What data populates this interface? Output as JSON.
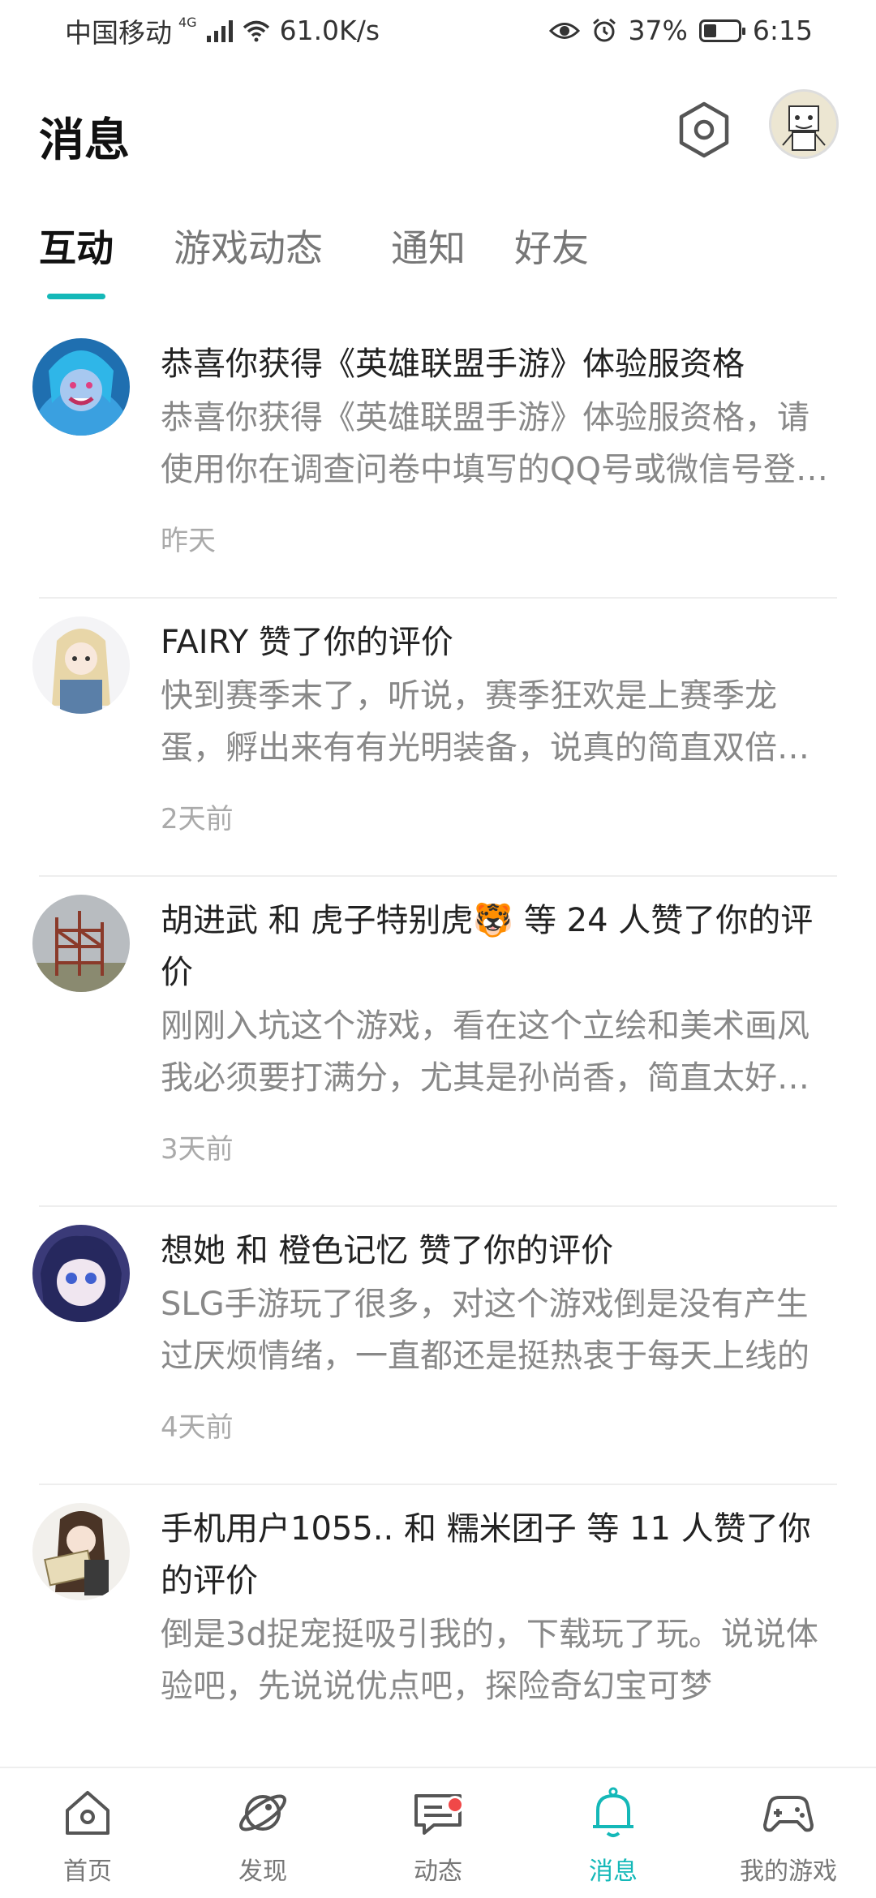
{
  "status_bar": {
    "carrier": "中国移动",
    "network": "4G",
    "speed": "61.0K/s",
    "battery": "37%",
    "battery_level": 0.37,
    "time": "6:15"
  },
  "header": {
    "title": "消息"
  },
  "tabs": [
    {
      "label": "互动",
      "active": true
    },
    {
      "label": "游戏动态",
      "active": false
    },
    {
      "label": "通知",
      "active": false
    },
    {
      "label": "好友",
      "active": false
    }
  ],
  "messages": [
    {
      "title": "恭喜你获得《英雄联盟手游》体验服资格",
      "preview": "恭喜你获得《英雄联盟手游》体验服资格，请使用你在调查问卷中填写的QQ号或微信号登录游戏",
      "time": "昨天"
    },
    {
      "title": "FAIRY 赞了你的评价",
      "preview": "快到赛季末了，听说，赛季狂欢是上赛季龙蛋，孵出来有有光明装备，说真的简直双倍快乐",
      "time": "2天前"
    },
    {
      "title": "胡进武 和 虎子特别虎🐯 等 24 人赞了你的评价",
      "preview": "刚刚入坑这个游戏，看在这个立绘和美术画风我必须要打满分，尤其是孙尚香，简直太好看了",
      "time": "3天前"
    },
    {
      "title": "想她 和 橙色记忆 赞了你的评价",
      "preview": "SLG手游玩了很多，对这个游戏倒是没有产生过厌烦情绪，一直都还是挺热衷于每天上线的",
      "time": "4天前"
    },
    {
      "title": "手机用户1055.. 和 糯米团子 等 11 人赞了你的评价",
      "preview": "倒是3d捉宠挺吸引我的，下载玩了玩。说说体验吧，先说说优点吧，探险奇幻宝可梦",
      "time": ""
    }
  ],
  "bottom_nav": [
    {
      "label": "首页",
      "icon": "home-icon",
      "active": false
    },
    {
      "label": "发现",
      "icon": "planet-icon",
      "active": false
    },
    {
      "label": "动态",
      "icon": "chat-icon",
      "active": false,
      "badge": true
    },
    {
      "label": "消息",
      "icon": "bell-icon",
      "active": true
    },
    {
      "label": "我的游戏",
      "icon": "gamepad-icon",
      "active": false
    }
  ],
  "colors": {
    "accent": "#14b8b8",
    "badge": "#f04848"
  }
}
